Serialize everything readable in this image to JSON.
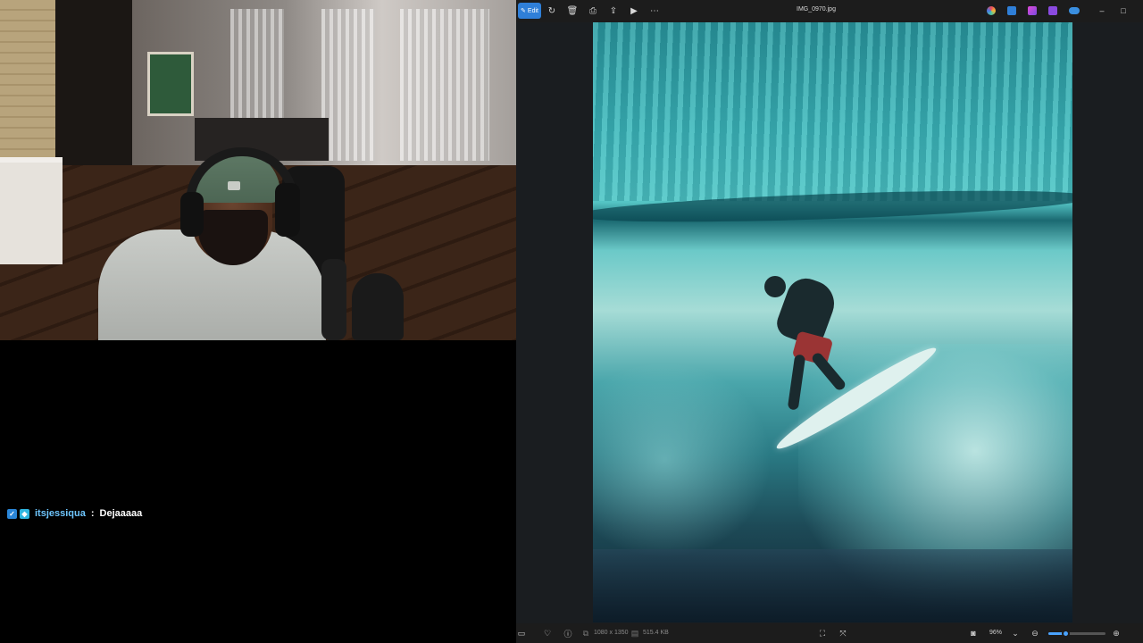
{
  "stream": {
    "chat": {
      "username": "itsjessiqua",
      "separator": ":",
      "message": "Dejaaaaa",
      "badges": [
        "verified-badge-icon",
        "cube-badge-icon"
      ],
      "username_color": "#6ec6ff"
    }
  },
  "photos_app": {
    "toolbar": {
      "edit_label": "Edit",
      "icons": [
        "rotate-icon",
        "delete-icon",
        "print-icon",
        "share-icon",
        "slideshow-icon",
        "more-icon"
      ]
    },
    "file_title": "IMG_0970.jpg",
    "window_controls": [
      "minimize-icon",
      "maximize-icon"
    ],
    "status": {
      "dimensions": "1080 x 1350",
      "file_size": "515.4 KB",
      "zoom_label": "96%",
      "zoom_fraction": 0.3
    },
    "accent_color": "#2f7fd8"
  }
}
